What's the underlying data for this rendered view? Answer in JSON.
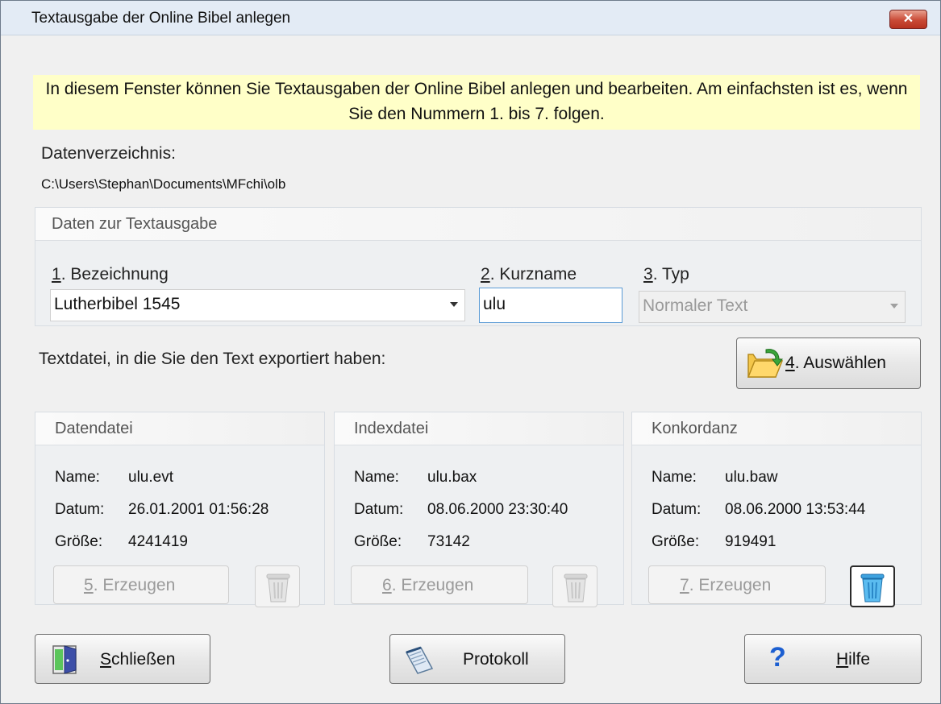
{
  "window": {
    "title": "Textausgabe der Online Bibel anlegen",
    "close_glyph": "✕"
  },
  "info_text": "In diesem Fenster können Sie Textausgaben der Online Bibel anlegen und bearbeiten. Am einfachsten ist es, wenn Sie den Nummern 1. bis 7. folgen.",
  "dir": {
    "label": "Datenverzeichnis:",
    "path": "C:\\Users\\Stephan\\Documents\\MFchi\\olb"
  },
  "group_text": {
    "title": "Daten zur Textausgabe",
    "bez_num": "1",
    "bez_label": ". Bezeichnung",
    "bez_value": "Lutherbibel 1545",
    "kurz_num": "2",
    "kurz_label": ". Kurzname",
    "kurz_value": "ulu",
    "typ_num": "3",
    "typ_label": ". Typ",
    "typ_value": "Normaler Text"
  },
  "export": {
    "label": "Textdatei, in die Sie den Text exportiert haben:",
    "btn_num": "4",
    "btn_label": ". Auswählen"
  },
  "keys": {
    "name": "Name:",
    "datum": "Datum:",
    "groesse": "Größe:"
  },
  "files": [
    {
      "title": "Datendatei",
      "name": "ulu.evt",
      "datum": "26.01.2001 01:56:28",
      "groesse": "4241419",
      "btn_num": "5",
      "btn_label": ". Erzeugen"
    },
    {
      "title": "Indexdatei",
      "name": "ulu.bax",
      "datum": "08.06.2000 23:30:40",
      "groesse": "73142",
      "btn_num": "6",
      "btn_label": ". Erzeugen"
    },
    {
      "title": "Konkordanz",
      "name": "ulu.baw",
      "datum": "08.06.2000 13:53:44",
      "groesse": "919491",
      "btn_num": "7",
      "btn_label": ". Erzeugen"
    }
  ],
  "footer": {
    "close_u": "S",
    "close_rest": "chließen",
    "protokoll": "Protokoll",
    "help_glyph": "?",
    "help_u": "H",
    "help_rest": "ilfe"
  },
  "colors": {
    "info_bg": "#ffffc8",
    "accent": "#1c5fd1",
    "close_red": "#c94a36"
  }
}
